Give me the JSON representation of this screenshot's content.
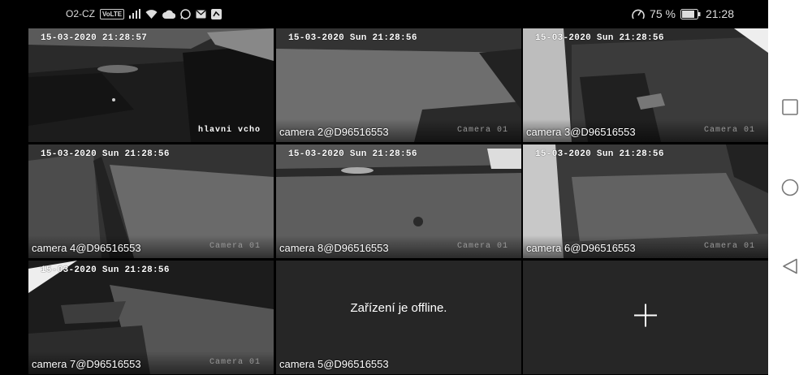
{
  "status_bar": {
    "carrier": "O2-CZ",
    "volte_badge": "VoLTE",
    "battery_percent": "75 %",
    "time": "21:28",
    "left_icons": [
      "signal-icon",
      "wifi-icon",
      "cloud-icon",
      "whatsapp-icon",
      "mail-icon",
      "app-icon"
    ],
    "right_icons": [
      "speedometer-icon",
      "battery-icon"
    ]
  },
  "tiles": [
    {
      "timestamp": "15-03-2020 21:28:57",
      "osd_channel": "hlavni vcho",
      "label": "",
      "selected": true
    },
    {
      "timestamp": "15-03-2020 Sun 21:28:56",
      "osd_channel": "Camera 01",
      "label": "camera 2@D96516553"
    },
    {
      "timestamp": "15-03-2020 Sun 21:28:56",
      "osd_channel": "Camera 01",
      "label": "camera 3@D96516553"
    },
    {
      "timestamp": "15-03-2020 Sun 21:28:56",
      "osd_channel": "Camera 01",
      "label": "camera 4@D96516553"
    },
    {
      "timestamp": "15-03-2020 Sun 21:28:56",
      "osd_channel": "Camera 01",
      "label": "camera 8@D96516553"
    },
    {
      "timestamp": "15-03-2020 Sun 21:28:56",
      "osd_channel": "Camera 01",
      "label": "camera 6@D96516553"
    },
    {
      "timestamp": "15-03-2020 Sun 21:28:56",
      "osd_channel": "Camera 01",
      "label": "camera 7@D96516553"
    },
    {
      "offline_message": "Zařízení je offline.",
      "label": "camera 5@D96516553"
    },
    {
      "action": "add-camera"
    }
  ],
  "nav_bar": {
    "buttons": [
      "recents-square-icon",
      "home-circle-icon",
      "back-triangle-icon"
    ]
  },
  "colors": {
    "selected_outline": "#3aa7a5",
    "tile_empty": "#262626",
    "nav_bg": "#ffffff"
  }
}
